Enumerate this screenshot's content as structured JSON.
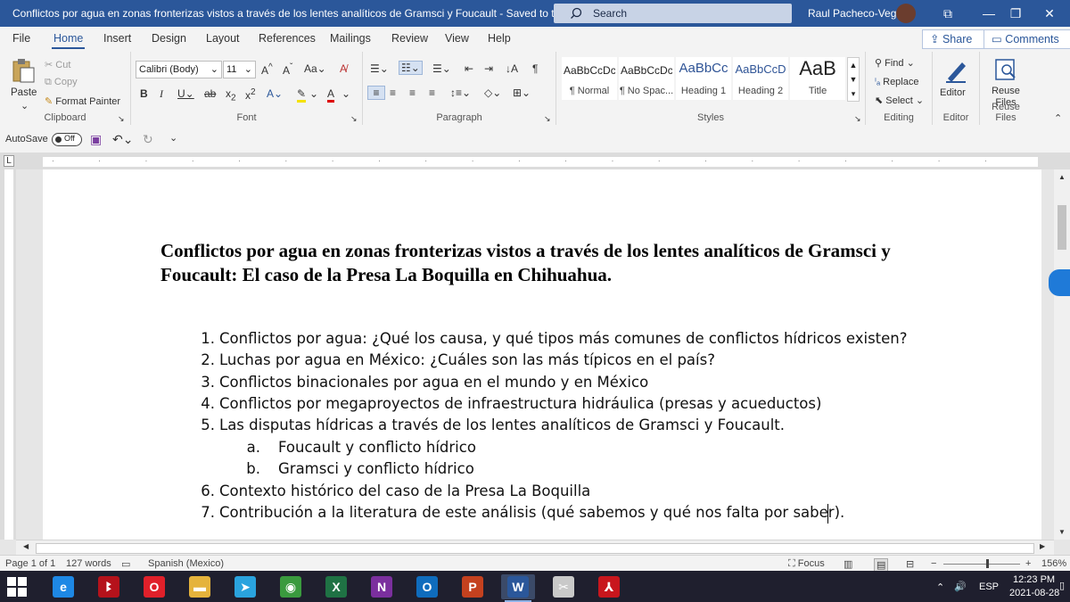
{
  "window": {
    "title": "Conflictos por agua en zonas fronterizas vistos a través de los lentes analíticos de Gramsci y Foucault  -  Saved to this PC  ⌄",
    "search_placeholder": "Search",
    "user_name": "Raul Pacheco-Vega",
    "controls": {
      "minimize": "—",
      "restore": "❐",
      "close": "✕",
      "ribbon_display": "⧉"
    }
  },
  "menu": {
    "tabs": [
      "File",
      "Home",
      "Insert",
      "Design",
      "Layout",
      "References",
      "Mailings",
      "Review",
      "View",
      "Help"
    ],
    "active_tab": "Home",
    "share": "Share",
    "comments": "Comments"
  },
  "ribbon": {
    "clipboard": {
      "paste": "Paste",
      "cut": "Cut",
      "copy": "Copy",
      "format_painter": "Format Painter",
      "label": "Clipboard"
    },
    "font": {
      "font_name": "Calibri (Body)",
      "font_size": "11",
      "label": "Font"
    },
    "paragraph": {
      "label": "Paragraph"
    },
    "styles": {
      "items": [
        {
          "sample": "AaBbCcDc",
          "name": "¶ Normal"
        },
        {
          "sample": "AaBbCcDc",
          "name": "¶ No Spac..."
        },
        {
          "sample": "AaBbCc",
          "name": "Heading 1"
        },
        {
          "sample": "AaBbCcD",
          "name": "Heading 2"
        },
        {
          "sample": "AaB",
          "name": "Title"
        }
      ],
      "label": "Styles"
    },
    "editing": {
      "find": "Find",
      "replace": "Replace",
      "select": "Select",
      "label": "Editing"
    },
    "editor": {
      "button": "Editor",
      "label": "Editor"
    },
    "reuse": {
      "button": "Reuse Files",
      "label": "Reuse Files"
    }
  },
  "qat": {
    "autosave": "AutoSave",
    "toggle": "Off"
  },
  "document": {
    "title": "Conflictos por agua en zonas fronterizas vistos a través de los lentes analíticos de Gramsci y Foucault: El caso de la Presa La Boquilla en Chihuahua.",
    "items": [
      {
        "num": "1.",
        "text": "Conflictos por agua: ¿Qué los causa, y qué tipos más comunes de conflictos hídricos existen?"
      },
      {
        "num": "2.",
        "text": "Luchas por agua en México: ¿Cuáles son las más típicos en el país?"
      },
      {
        "num": "3.",
        "text": "Conflictos binacionales por agua en el mundo y en México"
      },
      {
        "num": "4.",
        "text": "Conflictos por megaproyectos de infraestructura hidráulica (presas y acueductos)"
      },
      {
        "num": "5.",
        "text": "Las disputas hídricas a través de los lentes analíticos de Gramsci y Foucault."
      },
      {
        "num": "a.",
        "text": "Foucault y conflicto hídrico"
      },
      {
        "num": "b.",
        "text": "Gramsci y conflicto hídrico"
      },
      {
        "num": "6.",
        "text": "Contexto histórico del caso de la Presa La Boquilla"
      },
      {
        "num": "7.",
        "text": "Contribución a la literatura de este análisis (qué sabemos y qué nos falta por saber)."
      }
    ]
  },
  "status": {
    "page": "Page 1 of 1",
    "words": "127 words",
    "language": "Spanish (Mexico)",
    "focus": "Focus",
    "zoom": "156%",
    "zoom_minus": "−",
    "zoom_plus": "+"
  },
  "taskbar": {
    "language": "ESP",
    "time": "12:23 PM",
    "date": "2021-08-28",
    "apps": [
      {
        "name": "edge",
        "glyph": "e",
        "color": "#1e88e5"
      },
      {
        "name": "mendeley",
        "glyph": "ꔪ",
        "color": "#b5121b"
      },
      {
        "name": "opera",
        "glyph": "O",
        "color": "#e0202a"
      },
      {
        "name": "file-explorer",
        "glyph": "▬",
        "color": "#e5b33c"
      },
      {
        "name": "telegram",
        "glyph": "➤",
        "color": "#2aa3de"
      },
      {
        "name": "chrome",
        "glyph": "◉",
        "color": "#3a9a3e"
      },
      {
        "name": "excel",
        "glyph": "X",
        "color": "#1f7244"
      },
      {
        "name": "onenote",
        "glyph": "N",
        "color": "#7b2f9e"
      },
      {
        "name": "outlook",
        "glyph": "O",
        "color": "#0f6cbd"
      },
      {
        "name": "powerpoint",
        "glyph": "P",
        "color": "#c4411f"
      },
      {
        "name": "word",
        "glyph": "W",
        "color": "#2b579a"
      },
      {
        "name": "snipping-tool",
        "glyph": "✂",
        "color": "#c9c9c9"
      },
      {
        "name": "acrobat",
        "glyph": "⅄",
        "color": "#c8161d"
      }
    ]
  }
}
